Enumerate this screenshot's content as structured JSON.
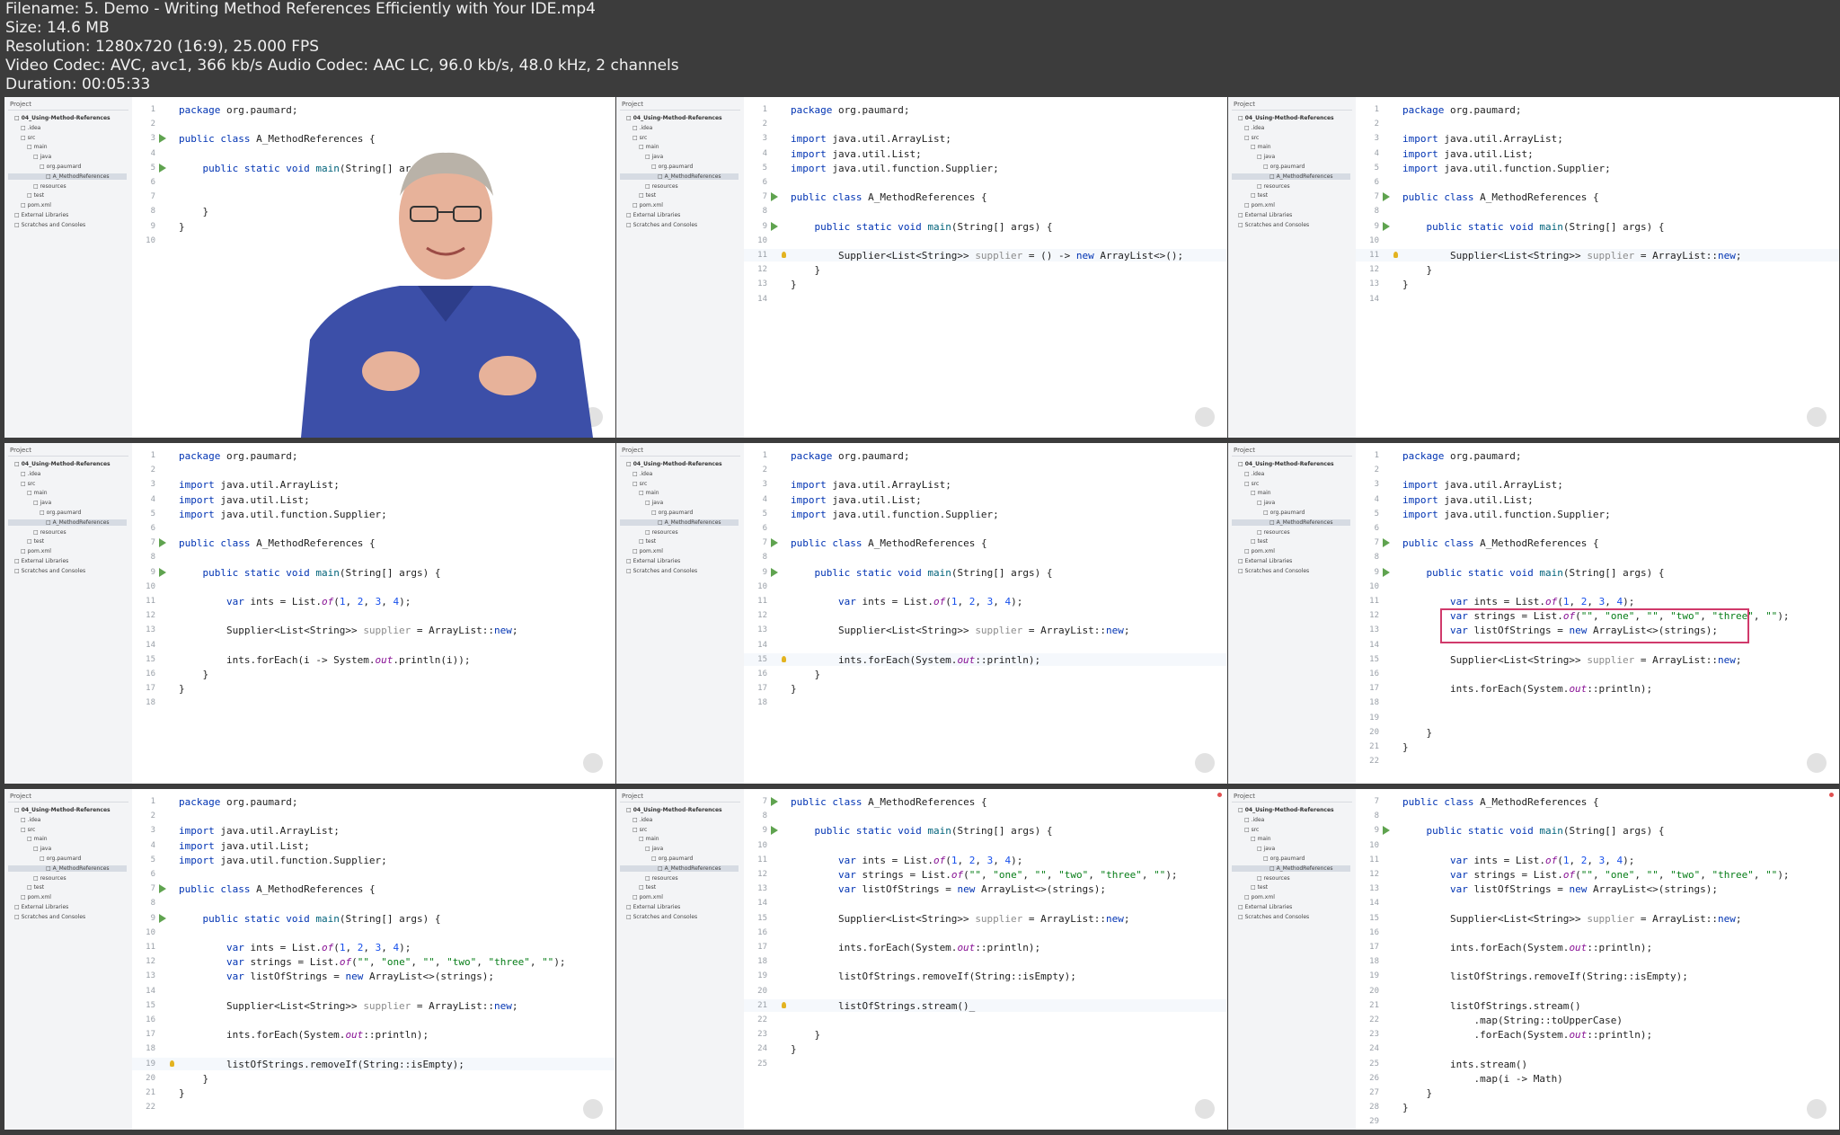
{
  "info": {
    "filename": "Filename: 5. Demo - Writing Method References Efficiently with Your IDE.mp4",
    "size": "Size: 14.6 MB",
    "resolution": "Resolution: 1280x720 (16:9), 25.000 FPS",
    "codec": "Video Codec: AVC, avc1, 366 kb/s Audio Codec: AAC LC, 96.0 kb/s, 48.0 kHz, 2 channels",
    "duration": "Duration: 00:05:33"
  },
  "sidebar": {
    "title": "Project",
    "items": [
      {
        "label": "04_Using-Method-References",
        "indent": 1,
        "bold": true
      },
      {
        "label": ".idea",
        "indent": 2
      },
      {
        "label": "src",
        "indent": 2
      },
      {
        "label": "main",
        "indent": 3
      },
      {
        "label": "java",
        "indent": 4
      },
      {
        "label": "org.paumard",
        "indent": 5
      },
      {
        "label": "A_MethodReferences",
        "indent": 6,
        "selected": true
      },
      {
        "label": "resources",
        "indent": 4
      },
      {
        "label": "test",
        "indent": 3
      },
      {
        "label": "pom.xml",
        "indent": 2
      },
      {
        "label": "External Libraries",
        "indent": 1
      },
      {
        "label": "Scratches and Consoles",
        "indent": 1
      }
    ]
  },
  "frames": [
    {
      "id": "f1",
      "startLine": 1,
      "presenter": true,
      "runLines": [
        3,
        5
      ],
      "lines": [
        "package org.paumard;",
        "",
        "public class A_MethodReferences {",
        "",
        "    public static void main(String[] ar",
        "",
        "",
        "    }",
        "}",
        ""
      ]
    },
    {
      "id": "f2",
      "startLine": 1,
      "runLines": [
        7,
        9
      ],
      "bulbLine": 11,
      "lines": [
        "package org.paumard;",
        "",
        "import java.util.ArrayList;",
        "import java.util.List;",
        "import java.util.function.Supplier;",
        "",
        "public class A_MethodReferences {",
        "",
        "    public static void main(String[] args) {",
        "",
        "        Supplier<List<String>> supplier = () -> new ArrayList<>();",
        "    }",
        "}",
        ""
      ]
    },
    {
      "id": "f3",
      "startLine": 1,
      "runLines": [
        7,
        9
      ],
      "bulbLine": 11,
      "lines": [
        "package org.paumard;",
        "",
        "import java.util.ArrayList;",
        "import java.util.List;",
        "import java.util.function.Supplier;",
        "",
        "public class A_MethodReferences {",
        "",
        "    public static void main(String[] args) {",
        "",
        "        Supplier<List<String>> supplier = ArrayList::new;",
        "    }",
        "}",
        ""
      ]
    },
    {
      "id": "f4",
      "startLine": 1,
      "runLines": [
        7,
        9
      ],
      "lines": [
        "package org.paumard;",
        "",
        "import java.util.ArrayList;",
        "import java.util.List;",
        "import java.util.function.Supplier;",
        "",
        "public class A_MethodReferences {",
        "",
        "    public static void main(String[] args) {",
        "",
        "        var ints = List.of(1, 2, 3, 4);",
        "",
        "        Supplier<List<String>> supplier = ArrayList::new;",
        "",
        "        ints.forEach(i -> System.out.println(i));",
        "    }",
        "}",
        ""
      ]
    },
    {
      "id": "f5",
      "startLine": 1,
      "runLines": [
        7,
        9
      ],
      "bulbLine": 15,
      "lines": [
        "package org.paumard;",
        "",
        "import java.util.ArrayList;",
        "import java.util.List;",
        "import java.util.function.Supplier;",
        "",
        "public class A_MethodReferences {",
        "",
        "    public static void main(String[] args) {",
        "",
        "        var ints = List.of(1, 2, 3, 4);",
        "",
        "        Supplier<List<String>> supplier = ArrayList::new;",
        "",
        "        ints.forEach(System.out::println);",
        "    }",
        "}",
        ""
      ]
    },
    {
      "id": "f6",
      "startLine": 1,
      "runLines": [
        7,
        9
      ],
      "highlight": [
        12,
        13
      ],
      "lines": [
        "package org.paumard;",
        "",
        "import java.util.ArrayList;",
        "import java.util.List;",
        "import java.util.function.Supplier;",
        "",
        "public class A_MethodReferences {",
        "",
        "    public static void main(String[] args) {",
        "",
        "        var ints = List.of(1, 2, 3, 4);",
        "        var strings = List.of(\"\", \"one\", \"\", \"two\", \"three\", \"\");",
        "        var listOfStrings = new ArrayList<>(strings);",
        "",
        "        Supplier<List<String>> supplier = ArrayList::new;",
        "",
        "        ints.forEach(System.out::println);",
        "",
        "",
        "    }",
        "}",
        ""
      ]
    },
    {
      "id": "f7",
      "startLine": 1,
      "runLines": [
        7,
        9
      ],
      "bulbLine": 19,
      "lines": [
        "package org.paumard;",
        "",
        "import java.util.ArrayList;",
        "import java.util.List;",
        "import java.util.function.Supplier;",
        "",
        "public class A_MethodReferences {",
        "",
        "    public static void main(String[] args) {",
        "",
        "        var ints = List.of(1, 2, 3, 4);",
        "        var strings = List.of(\"\", \"one\", \"\", \"two\", \"three\", \"\");",
        "        var listOfStrings = new ArrayList<>(strings);",
        "",
        "        Supplier<List<String>> supplier = ArrayList::new;",
        "",
        "        ints.forEach(System.out::println);",
        "",
        "        listOfStrings.removeIf(String::isEmpty);",
        "    }",
        "}",
        ""
      ]
    },
    {
      "id": "f8",
      "startLine": 7,
      "runLines": [
        7,
        9
      ],
      "bulbLine": 21,
      "dot": true,
      "lines": [
        "public class A_MethodReferences {",
        "",
        "    public static void main(String[] args) {",
        "",
        "        var ints = List.of(1, 2, 3, 4);",
        "        var strings = List.of(\"\", \"one\", \"\", \"two\", \"three\", \"\");",
        "        var listOfStrings = new ArrayList<>(strings);",
        "",
        "        Supplier<List<String>> supplier = ArrayList::new;",
        "",
        "        ints.forEach(System.out::println);",
        "",
        "        listOfStrings.removeIf(String::isEmpty);",
        "",
        "        listOfStrings.stream()_",
        "",
        "    }",
        "}",
        ""
      ]
    },
    {
      "id": "f9",
      "startLine": 7,
      "runLines": [
        9
      ],
      "dot": true,
      "lines": [
        "public class A_MethodReferences {",
        "",
        "    public static void main(String[] args) {",
        "",
        "        var ints = List.of(1, 2, 3, 4);",
        "        var strings = List.of(\"\", \"one\", \"\", \"two\", \"three\", \"\");",
        "        var listOfStrings = new ArrayList<>(strings);",
        "",
        "        Supplier<List<String>> supplier = ArrayList::new;",
        "",
        "        ints.forEach(System.out::println);",
        "",
        "        listOfStrings.removeIf(String::isEmpty);",
        "",
        "        listOfStrings.stream()",
        "            .map(String::toUpperCase)",
        "            .forEach(System.out::println);",
        "",
        "        ints.stream()",
        "            .map(i -> Math)",
        "    }",
        "}",
        ""
      ]
    }
  ],
  "colors": {
    "background": "#3c3c3c",
    "keyword": "#0033b3",
    "string": "#067d17",
    "number": "#1750eb",
    "muted": "#8c8c8c",
    "static": "#871094",
    "highlight": "#d03a6b"
  }
}
